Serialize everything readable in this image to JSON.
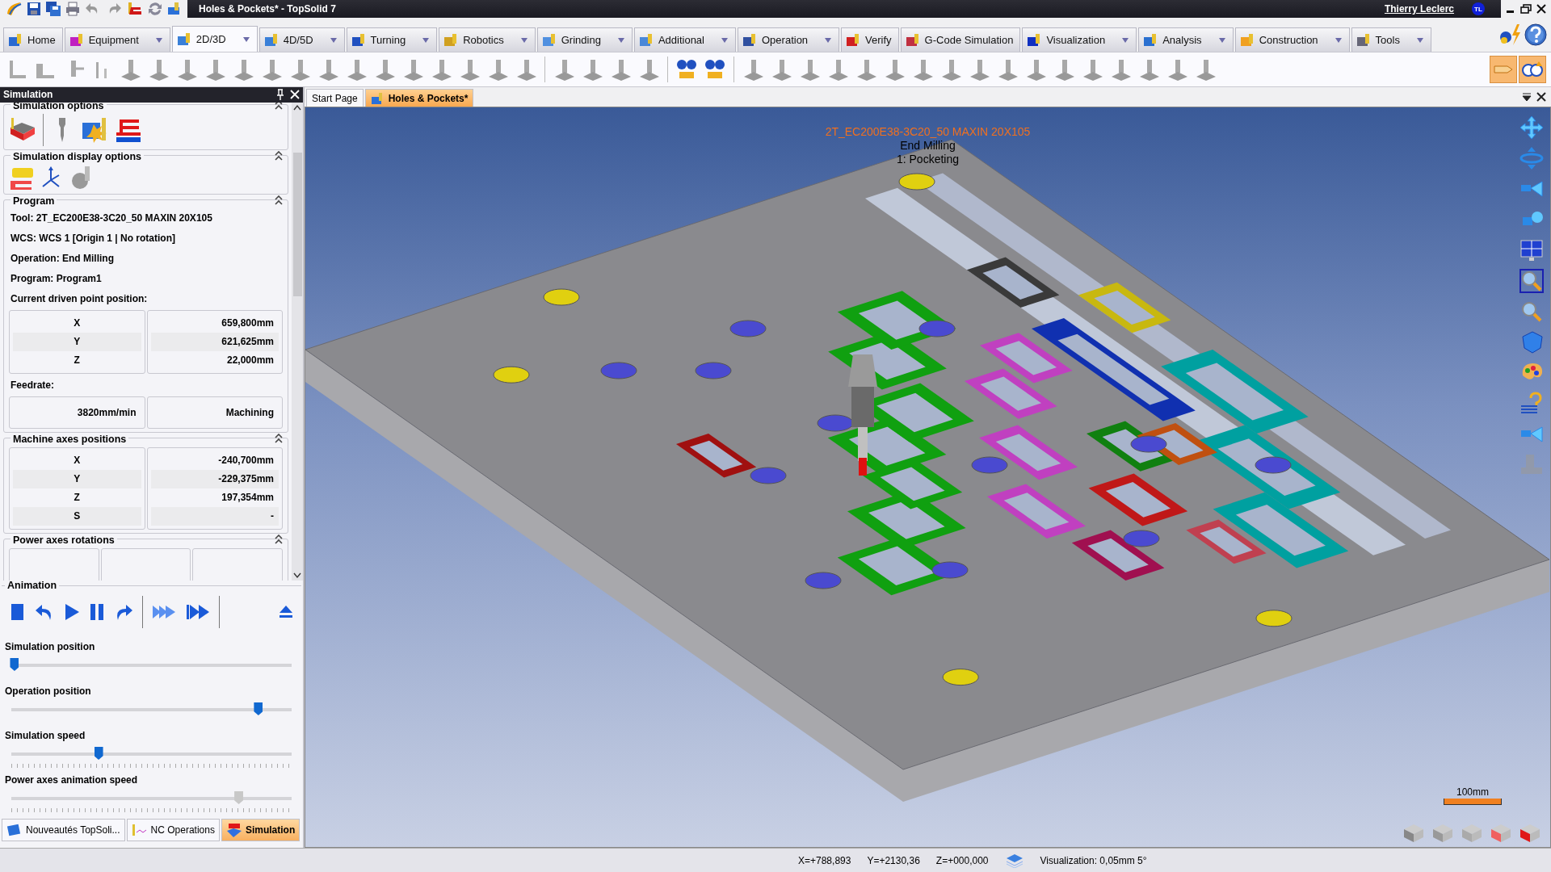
{
  "window": {
    "title": "Holes & Pockets* - TopSolid 7",
    "user": "Thierry Leclerc",
    "user_initials": "TL"
  },
  "ribbon_tabs": [
    {
      "label": "Home",
      "selected": false,
      "dropdown": false
    },
    {
      "label": "Equipment",
      "selected": false,
      "dropdown": true
    },
    {
      "label": "2D/3D",
      "selected": true,
      "dropdown": true
    },
    {
      "label": "4D/5D",
      "selected": false,
      "dropdown": true
    },
    {
      "label": "Turning",
      "selected": false,
      "dropdown": true
    },
    {
      "label": "Robotics",
      "selected": false,
      "dropdown": true
    },
    {
      "label": "Grinding",
      "selected": false,
      "dropdown": true
    },
    {
      "label": "Additional",
      "selected": false,
      "dropdown": true
    },
    {
      "label": "Operation",
      "selected": false,
      "dropdown": true
    },
    {
      "label": "Verify",
      "selected": false,
      "dropdown": false
    },
    {
      "label": "G-Code Simulation",
      "selected": false,
      "dropdown": false
    },
    {
      "label": "Visualization",
      "selected": false,
      "dropdown": true
    },
    {
      "label": "Analysis",
      "selected": false,
      "dropdown": true
    },
    {
      "label": "Construction",
      "selected": false,
      "dropdown": true
    },
    {
      "label": "Tools",
      "selected": false,
      "dropdown": true
    }
  ],
  "simulation_panel": {
    "title": "Simulation",
    "simulation_options": {
      "title": "Simulation options"
    },
    "display_options": {
      "title": "Simulation display options"
    },
    "program": {
      "title": "Program",
      "lines": [
        "Tool: 2T_EC200E38-3C20_50 MAXIN 20X105",
        "WCS: WCS 1 [Origin 1 | No rotation]",
        "Operation: End Milling",
        "Program: Program1",
        "Current driven point position:"
      ],
      "position": [
        {
          "axis": "X",
          "value": "659,800mm"
        },
        {
          "axis": "Y",
          "value": "621,625mm"
        },
        {
          "axis": "Z",
          "value": "22,000mm"
        }
      ],
      "feedrate_label": "Feedrate:",
      "feedrate": "3820mm/min",
      "motion": "Machining"
    },
    "machine_axes": {
      "title": "Machine axes positions",
      "rows": [
        {
          "axis": "X",
          "value": "-240,700mm"
        },
        {
          "axis": "Y",
          "value": "-229,375mm"
        },
        {
          "axis": "Z",
          "value": "197,354mm"
        },
        {
          "axis": "S",
          "value": "-"
        }
      ]
    },
    "power_axes": {
      "title": "Power axes rotations"
    },
    "animation": {
      "title": "Animation",
      "sliders": [
        {
          "label": "Simulation position",
          "level": 0.01,
          "disabled": false,
          "ticks": false
        },
        {
          "label": "Operation position",
          "level": 0.88,
          "disabled": false,
          "ticks": false
        },
        {
          "label": "Simulation speed",
          "level": 0.31,
          "disabled": false,
          "ticks": true
        },
        {
          "label": "Power axes animation speed",
          "level": 0.81,
          "disabled": true,
          "ticks": true
        }
      ]
    }
  },
  "panel_tabs": [
    {
      "label": "Nouveautés TopSoli...",
      "selected": false
    },
    {
      "label": "NC Operations",
      "selected": false
    },
    {
      "label": "Simulation",
      "selected": true
    }
  ],
  "document_tabs": [
    {
      "label": "Start Page",
      "selected": false
    },
    {
      "label": "Holes & Pockets*",
      "selected": true
    }
  ],
  "viewport": {
    "tool": "2T_EC200E38-3C20_50 MAXIN 20X105",
    "operation": "End Milling",
    "step": "1: Pocketing",
    "scale": "100mm"
  },
  "status_bar": {
    "x": "X=+788,893",
    "y": "Y=+2130,36",
    "z": "Z=+000,000",
    "visualization": "Visualization: 0,05mm 5°"
  }
}
